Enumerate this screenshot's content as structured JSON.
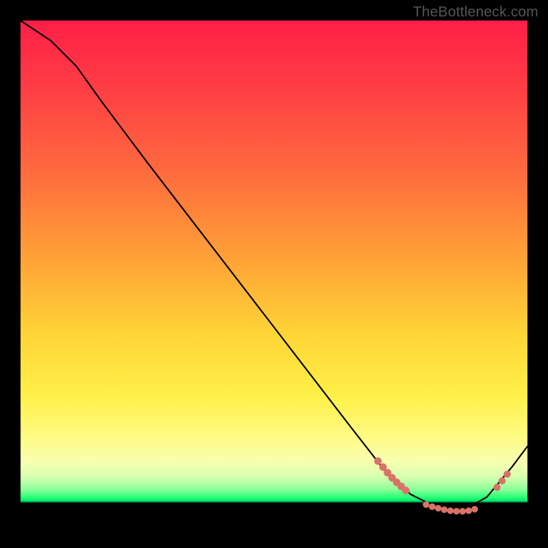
{
  "watermark": "TheBottleneck.com",
  "chart_data": {
    "type": "line",
    "title": "",
    "xlabel": "",
    "ylabel": "",
    "xlim": [
      0,
      1
    ],
    "ylim": [
      0,
      1
    ],
    "curve": [
      {
        "x": 0.0,
        "y": 1.0
      },
      {
        "x": 0.06,
        "y": 0.96
      },
      {
        "x": 0.11,
        "y": 0.91
      },
      {
        "x": 0.16,
        "y": 0.84
      },
      {
        "x": 0.25,
        "y": 0.72
      },
      {
        "x": 0.35,
        "y": 0.59
      },
      {
        "x": 0.45,
        "y": 0.46
      },
      {
        "x": 0.55,
        "y": 0.33
      },
      {
        "x": 0.65,
        "y": 0.2
      },
      {
        "x": 0.72,
        "y": 0.11
      },
      {
        "x": 0.77,
        "y": 0.065
      },
      {
        "x": 0.82,
        "y": 0.04
      },
      {
        "x": 0.87,
        "y": 0.032
      },
      {
        "x": 0.92,
        "y": 0.06
      },
      {
        "x": 0.97,
        "y": 0.12
      },
      {
        "x": 1.0,
        "y": 0.16
      }
    ],
    "dots_segment_a": [
      {
        "x": 0.705,
        "y": 0.131
      },
      {
        "x": 0.715,
        "y": 0.119
      },
      {
        "x": 0.724,
        "y": 0.108
      },
      {
        "x": 0.733,
        "y": 0.098
      },
      {
        "x": 0.742,
        "y": 0.089
      },
      {
        "x": 0.751,
        "y": 0.081
      },
      {
        "x": 0.76,
        "y": 0.073
      }
    ],
    "dots_segment_b": [
      {
        "x": 0.8,
        "y": 0.045
      },
      {
        "x": 0.812,
        "y": 0.041
      },
      {
        "x": 0.824,
        "y": 0.038
      },
      {
        "x": 0.836,
        "y": 0.035
      },
      {
        "x": 0.848,
        "y": 0.033
      },
      {
        "x": 0.86,
        "y": 0.032
      },
      {
        "x": 0.872,
        "y": 0.032
      },
      {
        "x": 0.884,
        "y": 0.033
      },
      {
        "x": 0.896,
        "y": 0.036
      }
    ],
    "dots_segment_c": [
      {
        "x": 0.94,
        "y": 0.079
      },
      {
        "x": 0.95,
        "y": 0.092
      },
      {
        "x": 0.96,
        "y": 0.105
      }
    ],
    "annotations": [],
    "legend": []
  }
}
